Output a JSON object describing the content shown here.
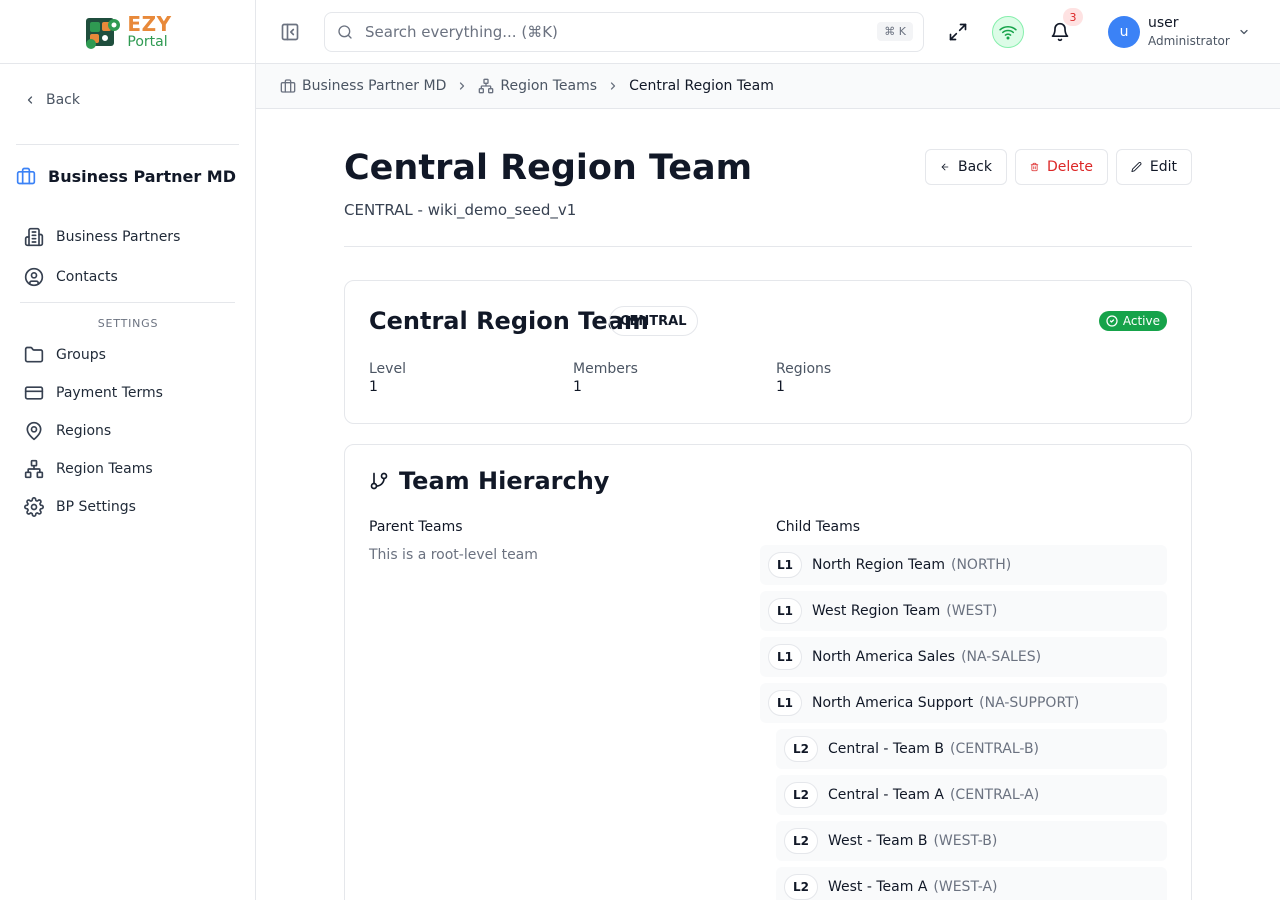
{
  "brand": {
    "line1": "EZY",
    "line2": "Portal"
  },
  "sidebar": {
    "back_label": "Back",
    "module_title": "Business Partner MD",
    "items": [
      {
        "label": "Business Partners",
        "icon": "building-icon"
      },
      {
        "label": "Contacts",
        "icon": "user-circle-icon"
      }
    ],
    "settings_label": "SETTINGS",
    "settings_items": [
      {
        "label": "Groups",
        "icon": "folder-icon"
      },
      {
        "label": "Payment Terms",
        "icon": "credit-card-icon"
      },
      {
        "label": "Regions",
        "icon": "map-pin-icon"
      },
      {
        "label": "Region Teams",
        "icon": "network-icon"
      },
      {
        "label": "BP Settings",
        "icon": "gear-icon"
      }
    ]
  },
  "header": {
    "search_placeholder": "Search everything... (⌘K)",
    "search_shortcut": "⌘ K",
    "notification_count": "3",
    "user": {
      "initial": "u",
      "name": "user",
      "role": "Administrator"
    }
  },
  "breadcrumb": {
    "items": [
      "Business Partner MD",
      "Region Teams"
    ],
    "current": "Central Region Team"
  },
  "page": {
    "title": "Central Region Team",
    "subtitle": "CENTRAL - wiki_demo_seed_v1",
    "actions": {
      "back": "Back",
      "delete": "Delete",
      "edit": "Edit"
    }
  },
  "summary": {
    "name": "Central Region Team",
    "code": "CENTRAL",
    "status": "Active",
    "status_color": "#16a34a",
    "stats": [
      {
        "label": "Level",
        "value": "1"
      },
      {
        "label": "Members",
        "value": "1"
      },
      {
        "label": "Regions",
        "value": "1"
      }
    ]
  },
  "hierarchy": {
    "title": "Team Hierarchy",
    "parent_label": "Parent Teams",
    "parent_empty": "This is a root-level team",
    "child_label": "Child Teams",
    "children": [
      {
        "level": "L1",
        "name": "North Region Team",
        "code": "(NORTH)"
      },
      {
        "level": "L1",
        "name": "West Region Team",
        "code": "(WEST)"
      },
      {
        "level": "L1",
        "name": "North America Sales",
        "code": "(NA-SALES)"
      },
      {
        "level": "L1",
        "name": "North America Support",
        "code": "(NA-SUPPORT)"
      },
      {
        "level": "L2",
        "name": "Central - Team B",
        "code": "(CENTRAL-B)"
      },
      {
        "level": "L2",
        "name": "Central - Team A",
        "code": "(CENTRAL-A)"
      },
      {
        "level": "L2",
        "name": "West - Team B",
        "code": "(WEST-B)"
      },
      {
        "level": "L2",
        "name": "West - Team A",
        "code": "(WEST-A)"
      }
    ]
  }
}
